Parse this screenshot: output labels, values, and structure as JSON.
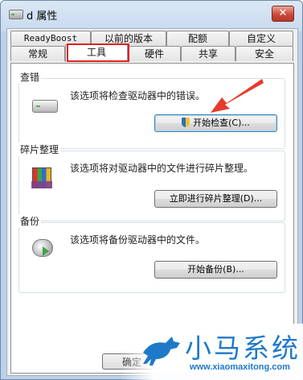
{
  "window": {
    "title": "d 属性",
    "close_glyph": "✕"
  },
  "tabs_row1": [
    "ReadyBoost",
    "以前的版本",
    "配额",
    "自定义"
  ],
  "tabs_row2": [
    "常规",
    "工具",
    "硬件",
    "共享",
    "安全"
  ],
  "active_tab": "工具",
  "groups": {
    "error_check": {
      "label": "查错",
      "description": "该选项将检查驱动器中的错误。",
      "button": "开始检查(C)..."
    },
    "defrag": {
      "label": "碎片整理",
      "description": "该选项将对驱动器中的文件进行碎片整理。",
      "button": "立即进行碎片整理(D)..."
    },
    "backup": {
      "label": "备份",
      "description": "该选项将备份驱动器中的文件。",
      "button": "开始备份(B)..."
    }
  },
  "footer": {
    "ok_button": "确定"
  },
  "watermark": {
    "brand": "小马系统",
    "url": "www.xiaomaxitong.com"
  },
  "colors": {
    "highlight": "#e02222",
    "arrow": "#e83a2a",
    "watermark": "#1e79c9"
  }
}
